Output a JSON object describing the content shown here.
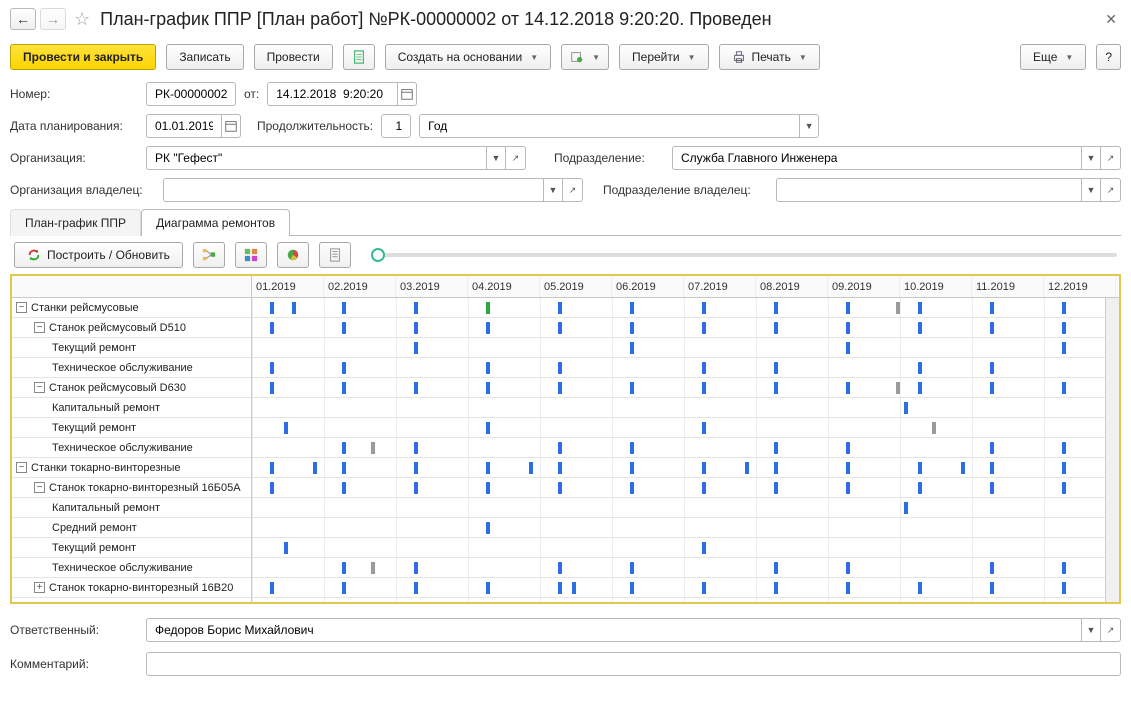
{
  "window": {
    "title": "План-график ППР [План работ] №РК-00000002 от 14.12.2018 9:20:20. Проведен"
  },
  "toolbar": {
    "post_close": "Провести и закрыть",
    "write": "Записать",
    "post": "Провести",
    "create_based": "Создать на основании",
    "goto": "Перейти",
    "print": "Печать",
    "more": "Еще",
    "help": "?"
  },
  "form": {
    "number_label": "Номер:",
    "number_value": "РК-00000002",
    "date_label": "от:",
    "date_value": "14.12.2018  9:20:20",
    "plan_date_label": "Дата планирования:",
    "plan_date_value": "01.01.2019",
    "duration_label": "Продолжительность:",
    "duration_value": "1",
    "duration_unit": "Год",
    "org_label": "Организация:",
    "org_value": "РК \"Гефест\"",
    "dept_label": "Подразделение:",
    "dept_value": "Служба Главного Инженера",
    "org_owner_label": "Организация владелец:",
    "org_owner_value": "",
    "dept_owner_label": "Подразделение владелец:",
    "dept_owner_value": ""
  },
  "tabs": {
    "plan": "План-график ППР",
    "diagram": "Диаграмма ремонтов"
  },
  "gantt_toolbar": {
    "build": "Построить / Обновить"
  },
  "months": [
    "01.2019",
    "02.2019",
    "03.2019",
    "04.2019",
    "05.2019",
    "06.2019",
    "07.2019",
    "08.2019",
    "09.2019",
    "10.2019",
    "11.2019",
    "12.2019"
  ],
  "tree": [
    {
      "level": 0,
      "expander": "-",
      "label": "Станки рейсмусовые"
    },
    {
      "level": 1,
      "expander": "-",
      "label": "Станок рейсмусовый D510"
    },
    {
      "level": 2,
      "expander": "",
      "label": "Текущий ремонт"
    },
    {
      "level": 2,
      "expander": "",
      "label": "Техническое обслуживание"
    },
    {
      "level": 1,
      "expander": "-",
      "label": "Станок рейсмусовый D630"
    },
    {
      "level": 2,
      "expander": "",
      "label": "Капитальный ремонт"
    },
    {
      "level": 2,
      "expander": "",
      "label": "Текущий ремонт"
    },
    {
      "level": 2,
      "expander": "",
      "label": "Техническое обслуживание"
    },
    {
      "level": 0,
      "expander": "-",
      "label": "Станки токарно-винторезные"
    },
    {
      "level": 1,
      "expander": "-",
      "label": "Станок токарно-винторезный 16Б05А"
    },
    {
      "level": 2,
      "expander": "",
      "label": "Капитальный ремонт"
    },
    {
      "level": 2,
      "expander": "",
      "label": "Средний ремонт"
    },
    {
      "level": 2,
      "expander": "",
      "label": "Текущий ремонт"
    },
    {
      "level": 2,
      "expander": "",
      "label": "Техническое обслуживание"
    },
    {
      "level": 1,
      "expander": "+",
      "label": "Станок токарно-винторезный 16В20"
    }
  ],
  "gantt_data": [
    {
      "row": 0,
      "bars": [
        {
          "m": 0,
          "c": "blue"
        },
        {
          "m": 0.3,
          "c": "blue"
        },
        {
          "m": 1,
          "c": "blue"
        },
        {
          "m": 2,
          "c": "blue"
        },
        {
          "m": 3,
          "c": "green"
        },
        {
          "m": 4,
          "c": "blue"
        },
        {
          "m": 5,
          "c": "blue"
        },
        {
          "m": 6,
          "c": "blue"
        },
        {
          "m": 7,
          "c": "blue"
        },
        {
          "m": 8,
          "c": "blue"
        },
        {
          "m": 8.7,
          "c": "grey"
        },
        {
          "m": 9,
          "c": "blue"
        },
        {
          "m": 10,
          "c": "blue"
        },
        {
          "m": 11,
          "c": "blue"
        }
      ]
    },
    {
      "row": 1,
      "bars": [
        {
          "m": 0,
          "c": "blue"
        },
        {
          "m": 1,
          "c": "blue"
        },
        {
          "m": 2,
          "c": "blue"
        },
        {
          "m": 3,
          "c": "blue"
        },
        {
          "m": 4,
          "c": "blue"
        },
        {
          "m": 5,
          "c": "blue"
        },
        {
          "m": 6,
          "c": "blue"
        },
        {
          "m": 7,
          "c": "blue"
        },
        {
          "m": 8,
          "c": "blue"
        },
        {
          "m": 9,
          "c": "blue"
        },
        {
          "m": 10,
          "c": "blue"
        },
        {
          "m": 11,
          "c": "blue"
        }
      ]
    },
    {
      "row": 2,
      "bars": [
        {
          "m": 2,
          "c": "blue"
        },
        {
          "m": 5,
          "c": "blue"
        },
        {
          "m": 8,
          "c": "blue"
        },
        {
          "m": 11,
          "c": "blue"
        }
      ]
    },
    {
      "row": 3,
      "bars": [
        {
          "m": 0,
          "c": "blue"
        },
        {
          "m": 1,
          "c": "blue"
        },
        {
          "m": 3,
          "c": "blue"
        },
        {
          "m": 4,
          "c": "blue"
        },
        {
          "m": 6,
          "c": "blue"
        },
        {
          "m": 7,
          "c": "blue"
        },
        {
          "m": 9,
          "c": "blue"
        },
        {
          "m": 10,
          "c": "blue"
        }
      ]
    },
    {
      "row": 4,
      "bars": [
        {
          "m": 0,
          "c": "blue"
        },
        {
          "m": 1,
          "c": "blue"
        },
        {
          "m": 2,
          "c": "blue"
        },
        {
          "m": 3,
          "c": "blue"
        },
        {
          "m": 4,
          "c": "blue"
        },
        {
          "m": 5,
          "c": "blue"
        },
        {
          "m": 6,
          "c": "blue"
        },
        {
          "m": 7,
          "c": "blue"
        },
        {
          "m": 8,
          "c": "blue"
        },
        {
          "m": 8.7,
          "c": "grey"
        },
        {
          "m": 9,
          "c": "blue"
        },
        {
          "m": 10,
          "c": "blue"
        },
        {
          "m": 11,
          "c": "blue"
        }
      ]
    },
    {
      "row": 5,
      "bars": [
        {
          "m": 8.8,
          "c": "blue"
        }
      ]
    },
    {
      "row": 6,
      "bars": [
        {
          "m": 0.2,
          "c": "blue"
        },
        {
          "m": 3,
          "c": "blue"
        },
        {
          "m": 6,
          "c": "blue"
        },
        {
          "m": 9.2,
          "c": "grey"
        }
      ]
    },
    {
      "row": 7,
      "bars": [
        {
          "m": 1,
          "c": "blue"
        },
        {
          "m": 1.4,
          "c": "grey"
        },
        {
          "m": 2,
          "c": "blue"
        },
        {
          "m": 4,
          "c": "blue"
        },
        {
          "m": 5,
          "c": "blue"
        },
        {
          "m": 7,
          "c": "blue"
        },
        {
          "m": 8,
          "c": "blue"
        },
        {
          "m": 10,
          "c": "blue"
        },
        {
          "m": 11,
          "c": "blue"
        }
      ]
    },
    {
      "row": 8,
      "bars": [
        {
          "m": 0,
          "c": "blue"
        },
        {
          "m": 0.6,
          "c": "blue"
        },
        {
          "m": 1,
          "c": "blue"
        },
        {
          "m": 2,
          "c": "blue"
        },
        {
          "m": 3,
          "c": "blue"
        },
        {
          "m": 3.6,
          "c": "blue"
        },
        {
          "m": 4,
          "c": "blue"
        },
        {
          "m": 5,
          "c": "blue"
        },
        {
          "m": 6,
          "c": "blue"
        },
        {
          "m": 6.6,
          "c": "blue"
        },
        {
          "m": 7,
          "c": "blue"
        },
        {
          "m": 8,
          "c": "blue"
        },
        {
          "m": 9,
          "c": "blue"
        },
        {
          "m": 9.6,
          "c": "blue"
        },
        {
          "m": 10,
          "c": "blue"
        },
        {
          "m": 11,
          "c": "blue"
        }
      ]
    },
    {
      "row": 9,
      "bars": [
        {
          "m": 0,
          "c": "blue"
        },
        {
          "m": 1,
          "c": "blue"
        },
        {
          "m": 2,
          "c": "blue"
        },
        {
          "m": 3,
          "c": "blue"
        },
        {
          "m": 4,
          "c": "blue"
        },
        {
          "m": 5,
          "c": "blue"
        },
        {
          "m": 6,
          "c": "blue"
        },
        {
          "m": 7,
          "c": "blue"
        },
        {
          "m": 8,
          "c": "blue"
        },
        {
          "m": 9,
          "c": "blue"
        },
        {
          "m": 10,
          "c": "blue"
        },
        {
          "m": 11,
          "c": "blue"
        }
      ]
    },
    {
      "row": 10,
      "bars": [
        {
          "m": 8.8,
          "c": "blue"
        }
      ]
    },
    {
      "row": 11,
      "bars": [
        {
          "m": 3,
          "c": "blue"
        }
      ]
    },
    {
      "row": 12,
      "bars": [
        {
          "m": 0.2,
          "c": "blue"
        },
        {
          "m": 6,
          "c": "blue"
        }
      ]
    },
    {
      "row": 13,
      "bars": [
        {
          "m": 1,
          "c": "blue"
        },
        {
          "m": 1.4,
          "c": "grey"
        },
        {
          "m": 2,
          "c": "blue"
        },
        {
          "m": 4,
          "c": "blue"
        },
        {
          "m": 5,
          "c": "blue"
        },
        {
          "m": 7,
          "c": "blue"
        },
        {
          "m": 8,
          "c": "blue"
        },
        {
          "m": 10,
          "c": "blue"
        },
        {
          "m": 11,
          "c": "blue"
        }
      ]
    },
    {
      "row": 14,
      "bars": [
        {
          "m": 0,
          "c": "blue"
        },
        {
          "m": 1,
          "c": "blue"
        },
        {
          "m": 2,
          "c": "blue"
        },
        {
          "m": 3,
          "c": "blue"
        },
        {
          "m": 4,
          "c": "blue"
        },
        {
          "m": 4.2,
          "c": "blue"
        },
        {
          "m": 5,
          "c": "blue"
        },
        {
          "m": 6,
          "c": "blue"
        },
        {
          "m": 7,
          "c": "blue"
        },
        {
          "m": 8,
          "c": "blue"
        },
        {
          "m": 9,
          "c": "blue"
        },
        {
          "m": 10,
          "c": "blue"
        },
        {
          "m": 11,
          "c": "blue"
        }
      ]
    }
  ],
  "footer": {
    "responsible_label": "Ответственный:",
    "responsible_value": "Федоров Борис Михайлович",
    "comment_label": "Комментарий:",
    "comment_value": ""
  }
}
